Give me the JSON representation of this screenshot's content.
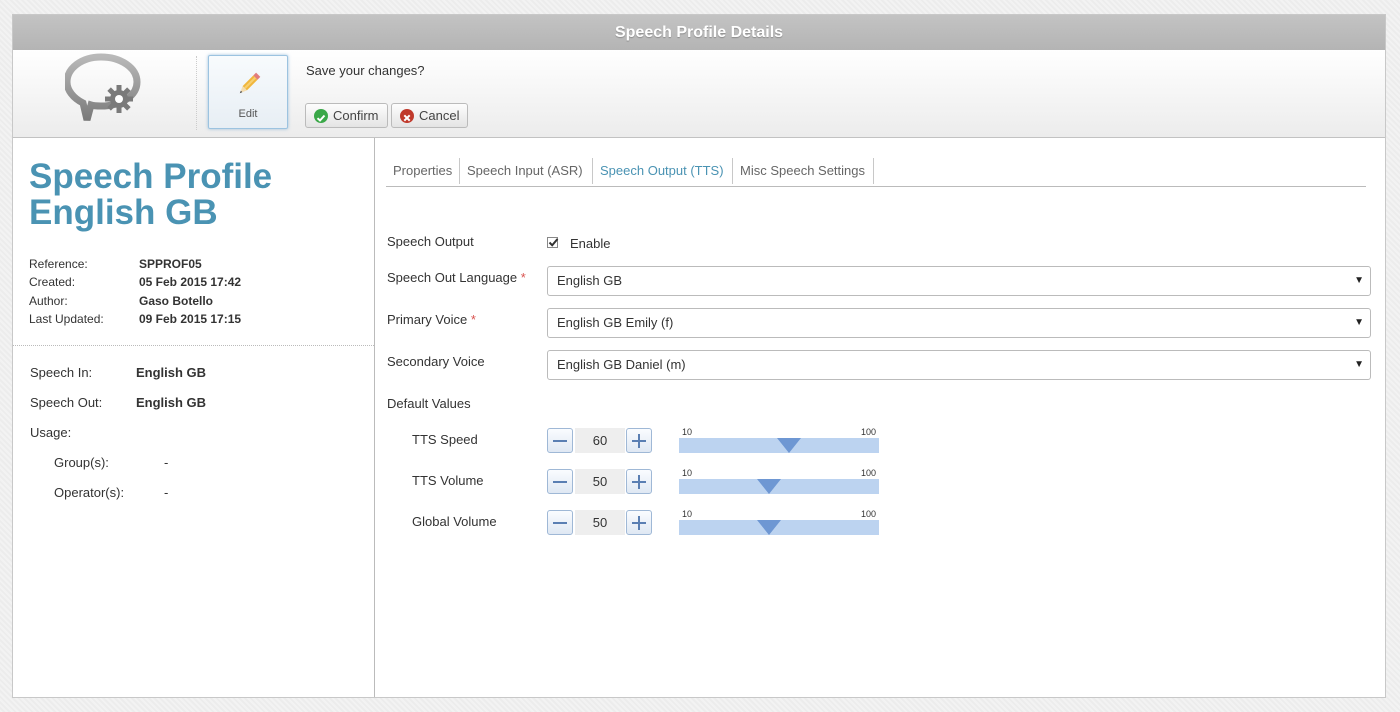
{
  "window": {
    "title": "Speech Profile Details"
  },
  "toolbar": {
    "edit_label": "Edit",
    "prompt": "Save your changes?",
    "confirm_label": "Confirm",
    "cancel_label": "Cancel"
  },
  "profile": {
    "title_line1": "Speech Profile",
    "title_line2": "English GB",
    "meta": [
      {
        "label": "Reference:",
        "value": "SPPROF05"
      },
      {
        "label": "Created:",
        "value": "05 Feb 2015 17:42"
      },
      {
        "label": "Author:",
        "value": "Gaso Botello"
      },
      {
        "label": "Last Updated:",
        "value": "09 Feb 2015 17:15"
      }
    ],
    "summary": {
      "speech_in_label": "Speech In:",
      "speech_in_value": "English GB",
      "speech_out_label": "Speech Out:",
      "speech_out_value": "English GB",
      "usage_label": "Usage:",
      "groups_label": "Group(s):",
      "groups_value": "-",
      "operators_label": "Operator(s):",
      "operators_value": "-"
    }
  },
  "tabs": [
    {
      "label": "Properties",
      "active": false
    },
    {
      "label": "Speech Input (ASR)",
      "active": false
    },
    {
      "label": "Speech Output (TTS)",
      "active": true
    },
    {
      "label": "Misc Speech Settings",
      "active": false
    }
  ],
  "form": {
    "speech_output_label": "Speech Output",
    "enable_label": "Enable",
    "enable_checked": true,
    "language_label": "Speech Out Language",
    "language_value": "English GB",
    "primary_label": "Primary Voice",
    "primary_value": "English GB Emily (f)",
    "secondary_label": "Secondary Voice",
    "secondary_value": "English GB Daniel (m)",
    "required_mark": "*",
    "defaults_label": "Default Values",
    "dropdown_arrow": "▼"
  },
  "sliders": [
    {
      "label": "TTS Speed",
      "value": "60",
      "min": "10",
      "max": "100"
    },
    {
      "label": "TTS Volume",
      "value": "50",
      "min": "10",
      "max": "100"
    },
    {
      "label": "Global Volume",
      "value": "50",
      "min": "10",
      "max": "100"
    }
  ],
  "colors": {
    "accent": "#4a93b3",
    "confirm_icon": "#3aa848",
    "cancel_icon": "#c0392b",
    "slider_track": "#bcd3f0",
    "slider_thumb": "#6e97d3"
  }
}
